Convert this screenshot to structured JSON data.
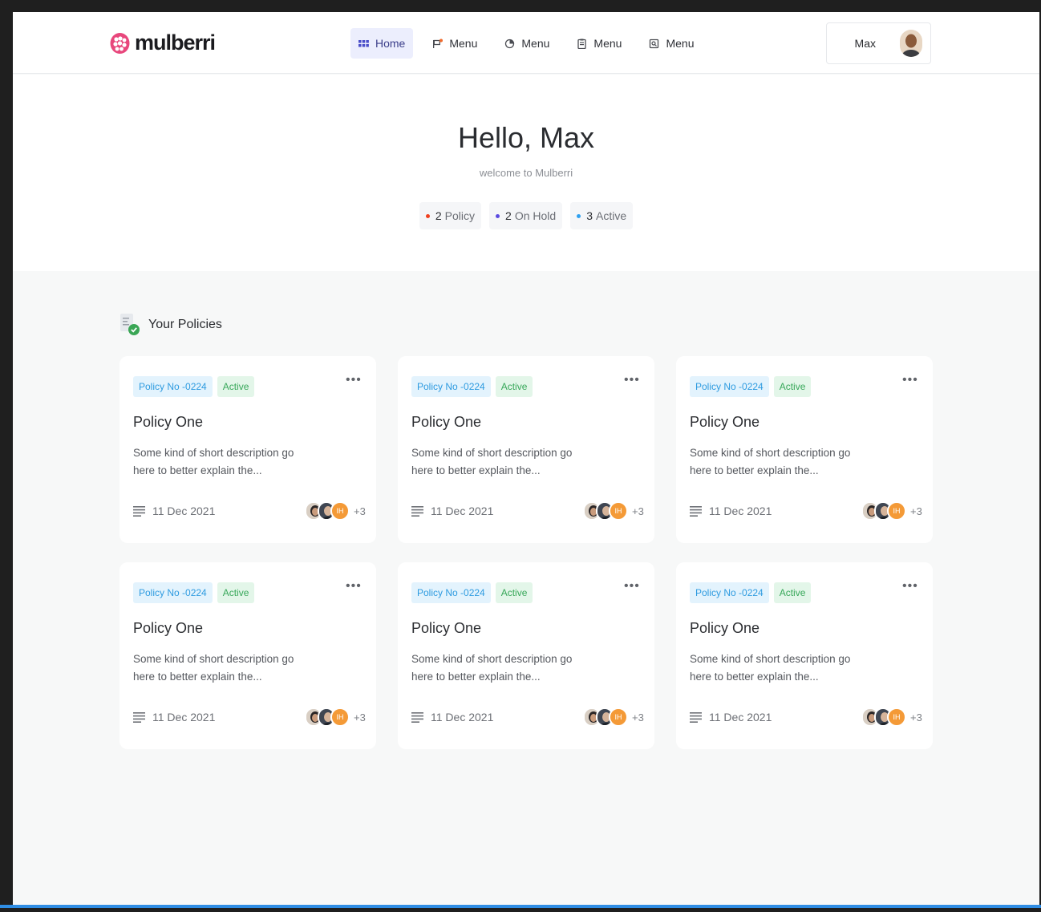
{
  "brand": {
    "name": "mulberri",
    "color": "#e8477c"
  },
  "nav": {
    "items": [
      {
        "label": "Home",
        "icon": "grid-icon",
        "active": true
      },
      {
        "label": "Menu",
        "icon": "flag-icon",
        "active": false
      },
      {
        "label": "Menu",
        "icon": "chart-icon",
        "active": false
      },
      {
        "label": "Menu",
        "icon": "clipboard-icon",
        "active": false
      },
      {
        "label": "Menu",
        "icon": "document-search-icon",
        "active": false
      }
    ]
  },
  "user": {
    "name": "Max"
  },
  "hero": {
    "greeting": "Hello, Max",
    "subtitle": "welcome to Mulberri",
    "stats": [
      {
        "count": "2",
        "label": "Policy",
        "color": "#f0401f"
      },
      {
        "count": "2",
        "label": "On Hold",
        "color": "#5a4ae0"
      },
      {
        "count": "3",
        "label": "Active",
        "color": "#2ea0f0"
      }
    ]
  },
  "section": {
    "title": "Your Policies"
  },
  "policies": [
    {
      "number": "Policy No -0224",
      "status": "Active",
      "title": "Policy One",
      "description": "Some kind of short description go here to better explain the...",
      "date": "11 Dec 2021",
      "initials": "IH",
      "extra": "+3"
    },
    {
      "number": "Policy No -0224",
      "status": "Active",
      "title": "Policy One",
      "description": "Some kind of short description go here to better explain the...",
      "date": "11 Dec 2021",
      "initials": "IH",
      "extra": "+3"
    },
    {
      "number": "Policy No -0224",
      "status": "Active",
      "title": "Policy One",
      "description": "Some kind of short description go here to better explain the...",
      "date": "11 Dec 2021",
      "initials": "IH",
      "extra": "+3"
    },
    {
      "number": "Policy No -0224",
      "status": "Active",
      "title": "Policy One",
      "description": "Some kind of short description go here to better explain the...",
      "date": "11 Dec 2021",
      "initials": "IH",
      "extra": "+3"
    },
    {
      "number": "Policy No -0224",
      "status": "Active",
      "title": "Policy One",
      "description": "Some kind of short description go here to better explain the...",
      "date": "11 Dec 2021",
      "initials": "IH",
      "extra": "+3"
    },
    {
      "number": "Policy No -0224",
      "status": "Active",
      "title": "Policy One",
      "description": "Some kind of short description go here to better explain the...",
      "date": "11 Dec 2021",
      "initials": "IH",
      "extra": "+3"
    }
  ]
}
